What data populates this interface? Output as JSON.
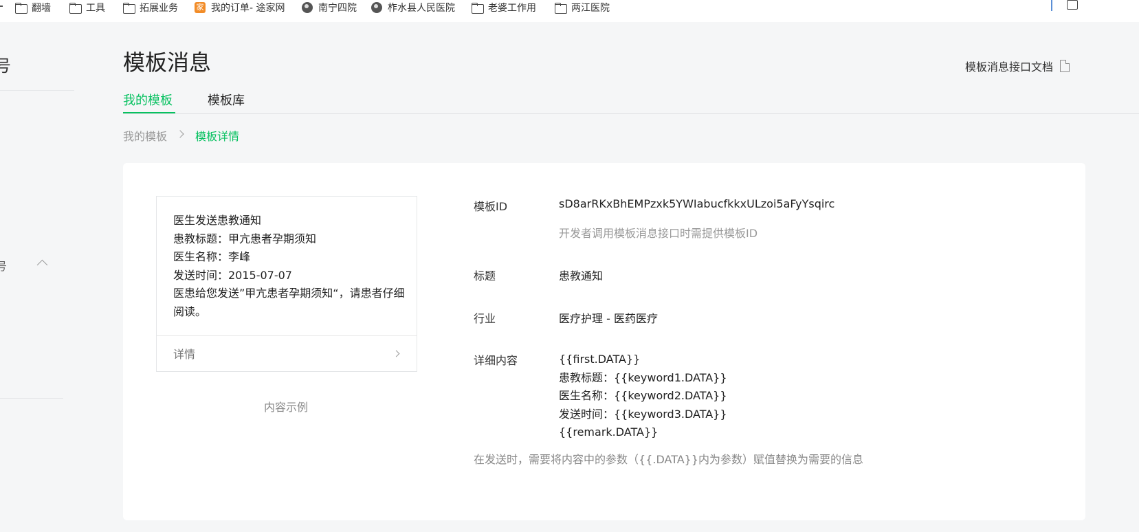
{
  "bookmarks": [
    {
      "label": "翻墙",
      "icon": "folder-icon"
    },
    {
      "label": "工具",
      "icon": "folder-icon"
    },
    {
      "label": "拓展业务",
      "icon": "folder-icon"
    },
    {
      "label": "我的订单- 途家网",
      "icon": "tujia-icon",
      "icon_text": "家"
    },
    {
      "label": "南宁四院",
      "icon": "globe-icon"
    },
    {
      "label": "柞水县人民医院",
      "icon": "globe-icon"
    },
    {
      "label": "老婆工作用",
      "icon": "folder-icon"
    },
    {
      "label": "两江医院",
      "icon": "folder-icon"
    }
  ],
  "header": {
    "title": "模板消息",
    "doc_link": "模板消息接口文档"
  },
  "tabs": [
    {
      "label": "我的模板",
      "active": true
    },
    {
      "label": "模板库",
      "active": false
    }
  ],
  "breadcrumb": {
    "parent": "我的模板",
    "current": "模板详情"
  },
  "preview": {
    "lines": [
      "医生发送患教通知",
      "患教标题：甲亢患者孕期须知",
      "医生名称：李峰",
      "发送时间：2015-07-07",
      "医患给您发送”甲亢患者孕期须知“，请患者仔细阅读。"
    ],
    "detail_label": "详情",
    "caption": "内容示例"
  },
  "details": {
    "template_id_label": "模板ID",
    "template_id": "sD8arRKxBhEMPzxk5YWIabucfkkxULzoi5aFyYsqirc",
    "template_id_hint": "开发者调用模板消息接口时需提供模板ID",
    "title_label": "标题",
    "title": "患教通知",
    "industry_label": "行业",
    "industry": "医疗护理 - 医药医疗",
    "content_label": "详细内容",
    "content_lines": [
      "{{first.DATA}}",
      "患教标题：{{keyword1.DATA}}",
      "医生名称：{{keyword2.DATA}}",
      "发送时间：{{keyword3.DATA}}",
      "{{remark.DATA}}"
    ],
    "note": "在发送时，需要将内容中的参数（{{.DATA}}内为参数）赋值替换为需要的信息"
  },
  "colors": {
    "accent": "#07c160",
    "background": "#f5f6f7",
    "card": "#ffffff"
  }
}
